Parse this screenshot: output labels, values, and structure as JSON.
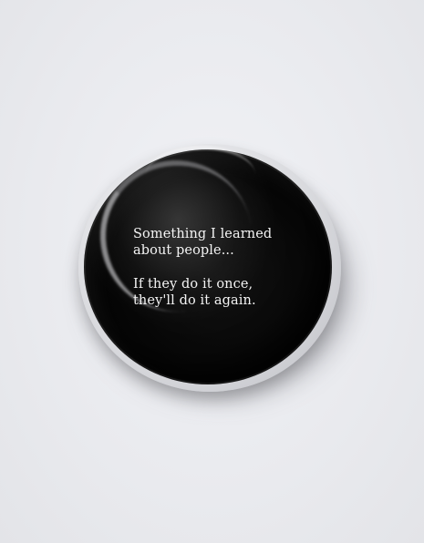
{
  "badge": {
    "lines_top": [
      "Something I learned",
      "about people..."
    ],
    "lines_bottom": [
      "If they do it once,",
      "they'll do it again."
    ],
    "colors": {
      "badge_face": "#000000",
      "text": "#f4f4f4",
      "background": "#ecedf1"
    }
  }
}
